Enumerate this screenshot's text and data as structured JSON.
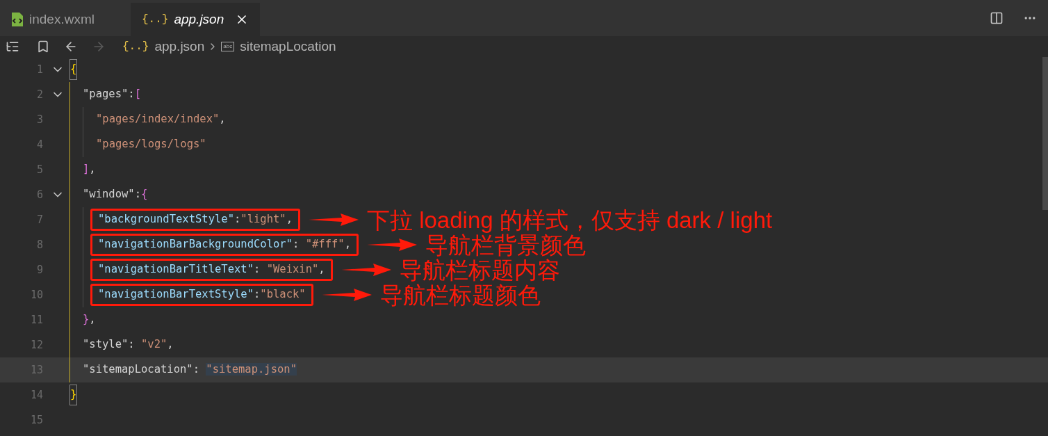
{
  "tabs": [
    {
      "kind": "wxml",
      "label": "index.wxml",
      "selected": false,
      "preview": false
    },
    {
      "kind": "json",
      "icon_text": "{..}",
      "label": "app.json",
      "selected": true,
      "preview": true
    }
  ],
  "toolbar": {
    "back": {
      "disabled": false
    },
    "forward": {
      "disabled": true
    }
  },
  "breadcrumbs": [
    {
      "kind": "file",
      "icon_text": "{..}",
      "label": "app.json"
    },
    {
      "kind": "symbol",
      "icon_text": "abc",
      "label": "sitemapLocation"
    }
  ],
  "lines": [
    {
      "number": "1",
      "fold": true,
      "bracket_match": true,
      "tokens": [
        {
          "kind": "brace1",
          "text": "{"
        }
      ],
      "children": [
        {
          "number": "2",
          "fold": true,
          "tokens": [
            {
              "kind": "key",
              "text": "\"pages\""
            },
            {
              "kind": "punct",
              "text": ":"
            },
            {
              "kind": "brace2",
              "text": "["
            }
          ],
          "children": [
            {
              "number": "3",
              "tokens": [
                {
                  "kind": "string",
                  "text": "\"pages/index/index\""
                },
                {
                  "kind": "punct",
                  "text": ","
                }
              ]
            },
            {
              "number": "4",
              "tokens": [
                {
                  "kind": "string",
                  "text": "\"pages/logs/logs\""
                }
              ]
            }
          ]
        },
        {
          "number": "5",
          "tokens": [
            {
              "kind": "brace2",
              "text": "]"
            },
            {
              "kind": "punct",
              "text": ","
            }
          ]
        },
        {
          "number": "6",
          "fold": true,
          "tokens": [
            {
              "kind": "key",
              "text": "\"window\""
            },
            {
              "kind": "punct",
              "text": ":"
            },
            {
              "kind": "brace2",
              "text": "{"
            }
          ],
          "children": [
            {
              "number": "7",
              "boxed": true,
              "annotation": "下拉 loading 的样式，仅支持 dark / light",
              "tokens": [
                {
                  "kind": "key2",
                  "text": "\"backgroundTextStyle\""
                },
                {
                  "kind": "punct",
                  "text": ":"
                },
                {
                  "kind": "string",
                  "text": "\"light\""
                },
                {
                  "kind": "punct",
                  "text": ","
                }
              ]
            },
            {
              "number": "8",
              "boxed": true,
              "annotation": "导航栏背景颜色",
              "tokens": [
                {
                  "kind": "key2",
                  "text": "\"navigationBarBackgroundColor\""
                },
                {
                  "kind": "punct",
                  "text": ": "
                },
                {
                  "kind": "string",
                  "text": "\"#fff\""
                },
                {
                  "kind": "punct",
                  "text": ","
                }
              ]
            },
            {
              "number": "9",
              "boxed": true,
              "annotation": "导航栏标题内容",
              "tokens": [
                {
                  "kind": "key2",
                  "text": "\"navigationBarTitleText\""
                },
                {
                  "kind": "punct",
                  "text": ": "
                },
                {
                  "kind": "string",
                  "text": "\"Weixin\""
                },
                {
                  "kind": "punct",
                  "text": ","
                }
              ]
            },
            {
              "number": "10",
              "boxed": true,
              "annotation": "导航栏标题颜色",
              "tokens": [
                {
                  "kind": "key2",
                  "text": "\"navigationBarTextStyle\""
                },
                {
                  "kind": "punct",
                  "text": ":"
                },
                {
                  "kind": "string",
                  "text": "\"black\""
                }
              ]
            }
          ]
        },
        {
          "number": "11",
          "tokens": [
            {
              "kind": "brace2",
              "text": "}"
            },
            {
              "kind": "punct",
              "text": ","
            }
          ]
        },
        {
          "number": "12",
          "tokens": [
            {
              "kind": "key",
              "text": "\"style\""
            },
            {
              "kind": "punct",
              "text": ": "
            },
            {
              "kind": "string",
              "text": "\"v2\""
            },
            {
              "kind": "punct",
              "text": ","
            }
          ]
        },
        {
          "number": "13",
          "current": true,
          "tokens": [
            {
              "kind": "key",
              "text": "\"sitemapLocation\""
            },
            {
              "kind": "punct",
              "text": ": "
            },
            {
              "kind": "match",
              "text": "\"sitemap.json\""
            }
          ]
        }
      ]
    },
    {
      "number": "14",
      "bracket_match": true,
      "tokens": [
        {
          "kind": "brace1",
          "text": "}"
        }
      ]
    },
    {
      "number": "15"
    }
  ]
}
